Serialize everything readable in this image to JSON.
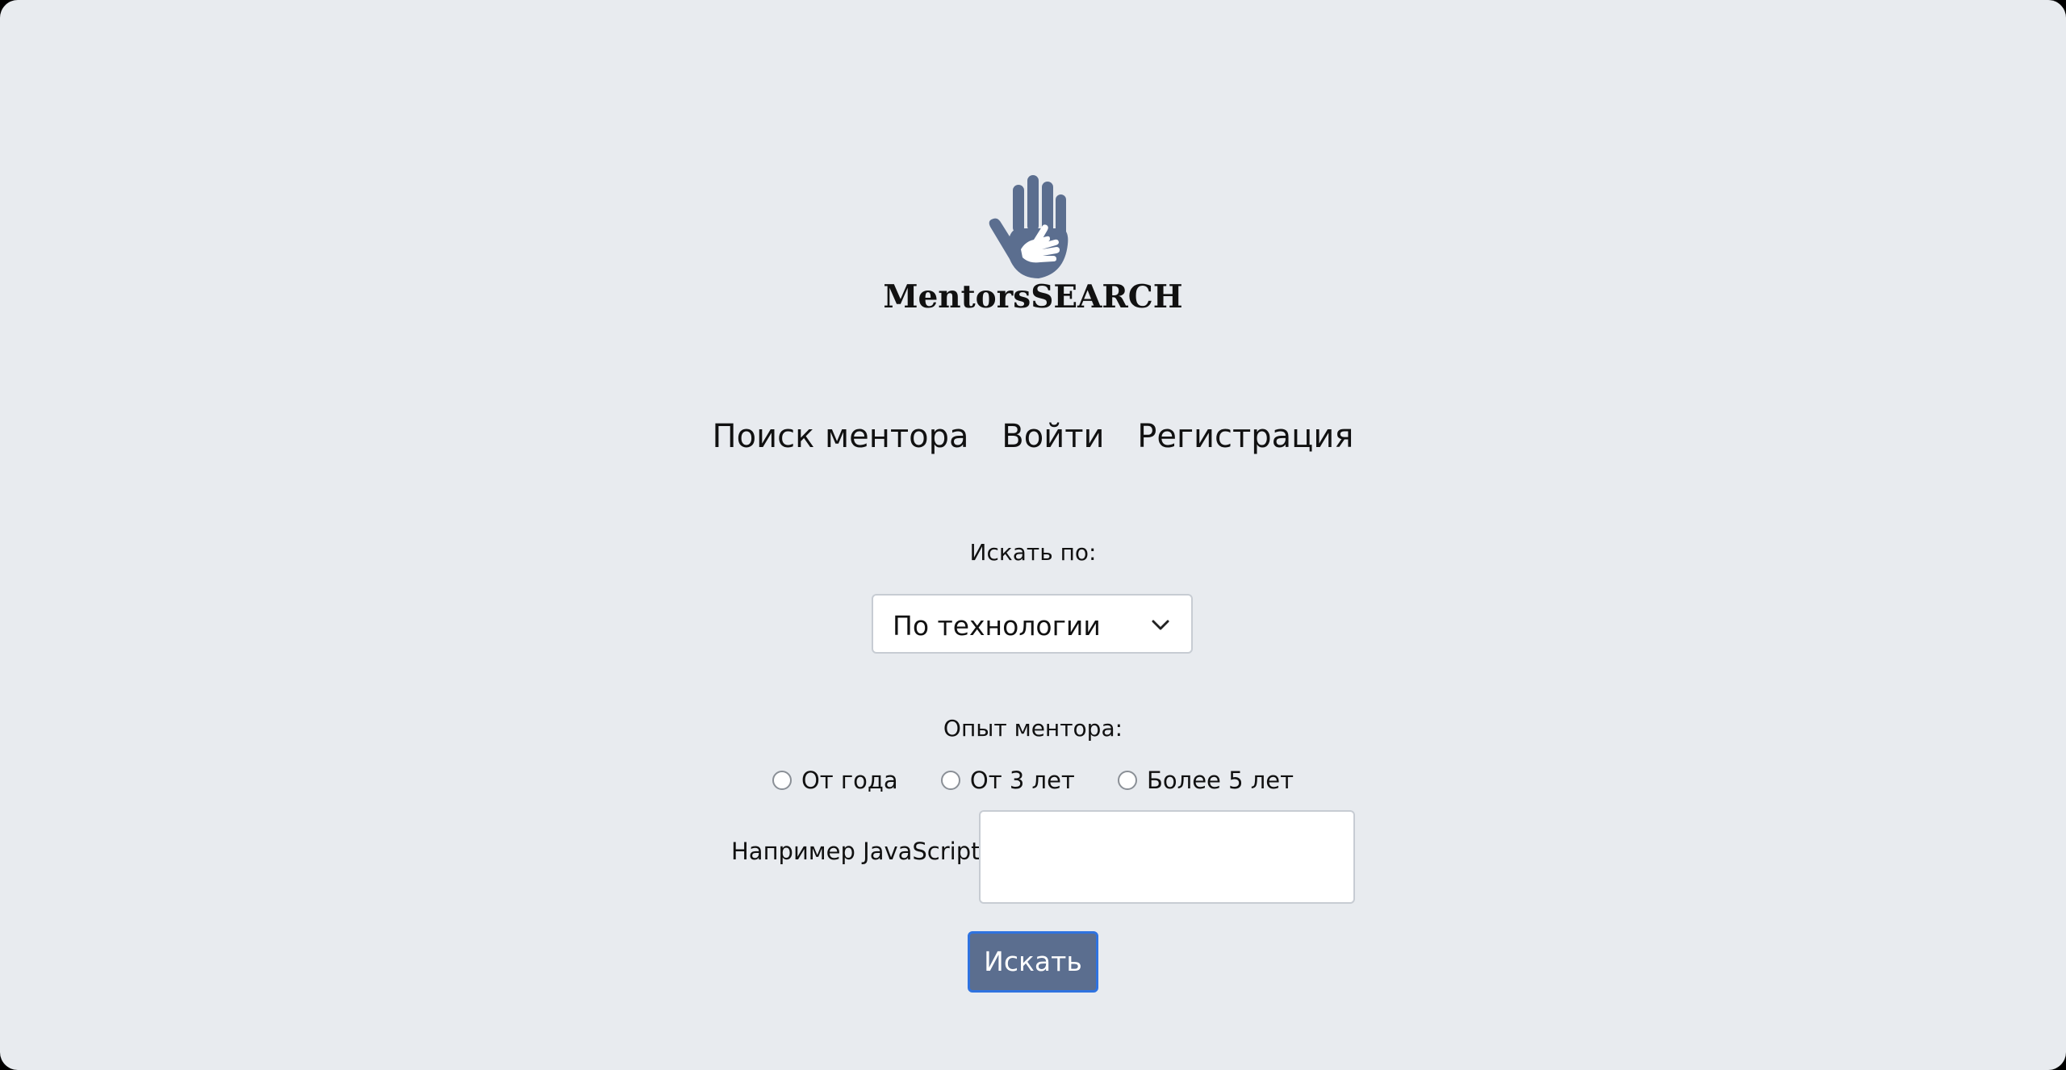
{
  "logo": {
    "text": "MentorsSEARCH",
    "icon": "hands-icon",
    "color": "#5b6e8f"
  },
  "nav": {
    "items": [
      {
        "label": "Поиск ментора"
      },
      {
        "label": "Войти"
      },
      {
        "label": "Регистрация"
      }
    ]
  },
  "search_by": {
    "label": "Искать по:",
    "selected": "По технологии",
    "icon": "chevron-down-icon"
  },
  "experience": {
    "label": "Опыт ментора:",
    "options": [
      {
        "label": "От года",
        "checked": false
      },
      {
        "label": "От 3 лет",
        "checked": false
      },
      {
        "label": "Более 5 лет",
        "checked": false
      }
    ]
  },
  "query": {
    "label": "Например JavaScript",
    "value": ""
  },
  "submit": {
    "label": "Искать",
    "color": "#5b6e8f",
    "border_color": "#2f73e0"
  },
  "colors": {
    "background": "#e8ebef"
  }
}
